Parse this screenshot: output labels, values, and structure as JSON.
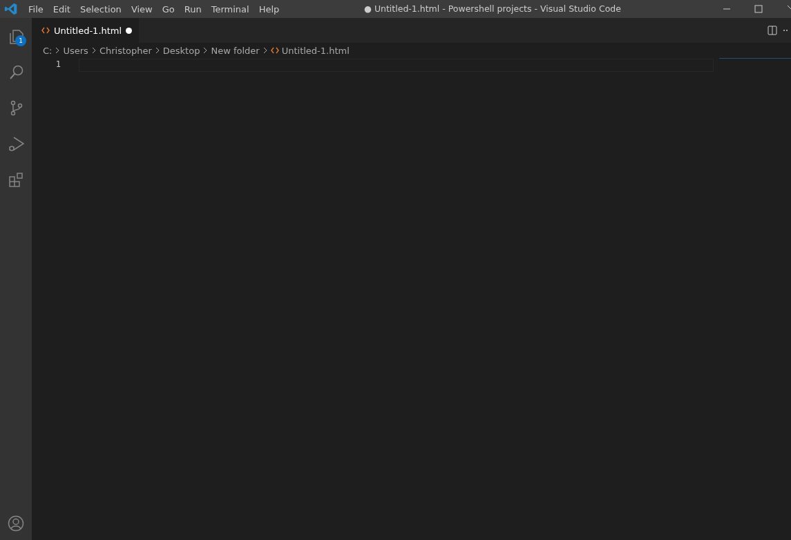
{
  "title_bar": {
    "menus": [
      "File",
      "Edit",
      "Selection",
      "View",
      "Go",
      "Run",
      "Terminal",
      "Help"
    ],
    "title": "● Untitled-1.html - Powershell projects - Visual Studio Code"
  },
  "activity_bar": {
    "items": [
      {
        "kind": "explorer",
        "badge": "1"
      },
      {
        "kind": "search"
      },
      {
        "kind": "source-control"
      },
      {
        "kind": "run-debug"
      },
      {
        "kind": "extensions"
      }
    ],
    "bottom_items": [
      {
        "kind": "account"
      }
    ]
  },
  "tabs": [
    {
      "label": "Untitled-1.html",
      "selected": true,
      "dirty": true
    }
  ],
  "breadcrumbs": [
    "C:",
    "Users",
    "Christopher",
    "Desktop",
    "New folder",
    "Untitled-1.html"
  ],
  "editor": {
    "line_numbers": [
      "1"
    ]
  }
}
